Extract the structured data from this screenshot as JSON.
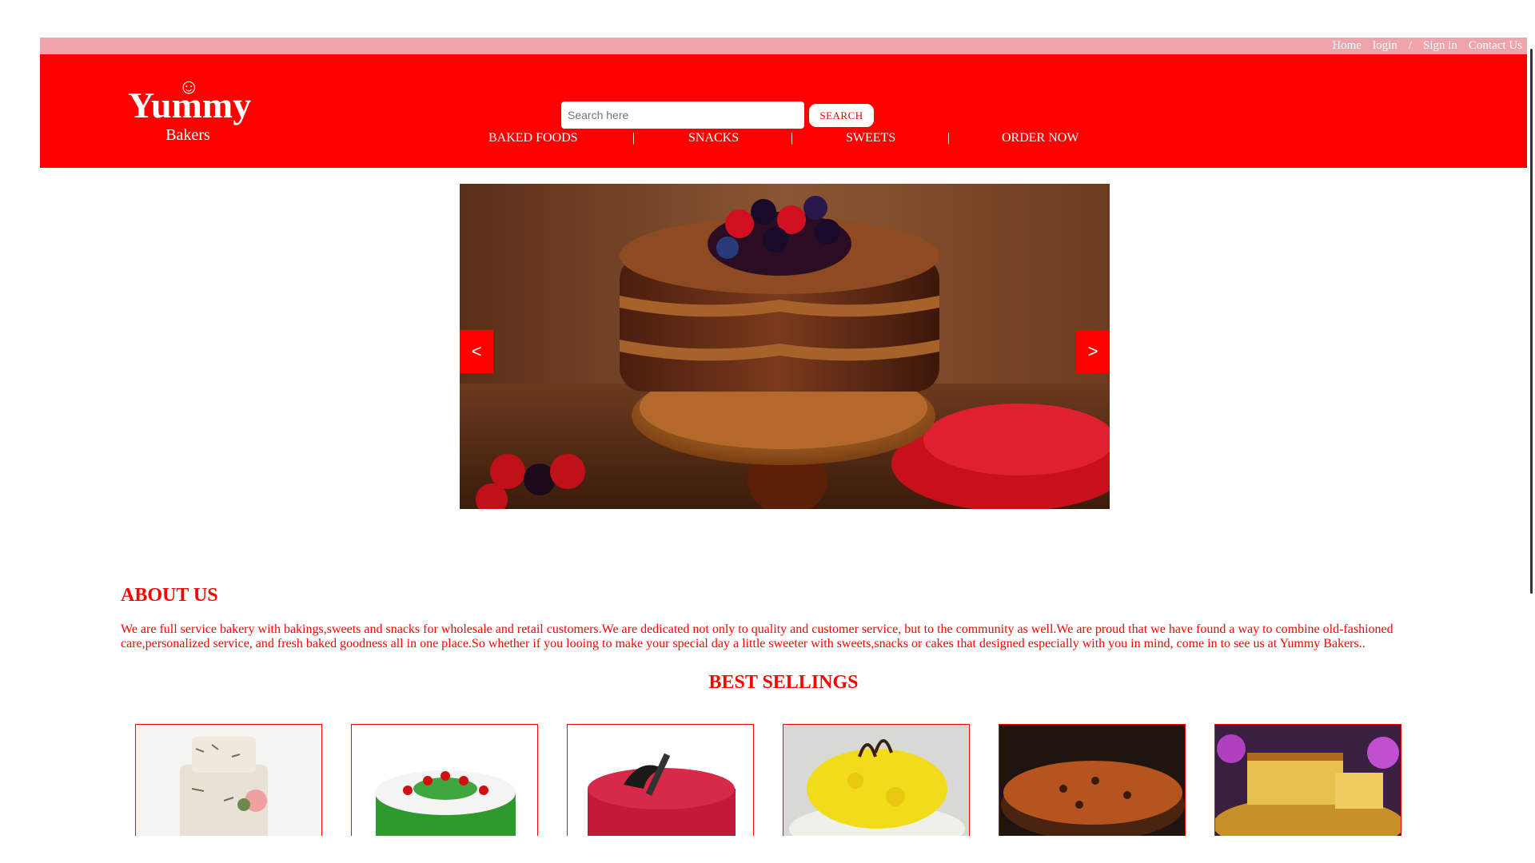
{
  "top_links": [
    "Home",
    "login",
    "/",
    "Sign in",
    "Contact Us"
  ],
  "logo": {
    "icon": "smiley-icon",
    "name": "Yummy",
    "sub": "Bakers"
  },
  "search": {
    "placeholder": "Search here",
    "button": "SEARCH"
  },
  "nav": {
    "items": [
      "BAKED FOODS",
      "SNACKS",
      "SWEETS",
      "ORDER NOW"
    ],
    "separator": "|"
  },
  "slider": {
    "prev": "<",
    "next": ">",
    "image": "chocolate-layer-cake-with-berries"
  },
  "about": {
    "title": "ABOUT US",
    "text": "We are full service bakery with bakings,sweets and snacks for wholesale and retail customers.We are dedicated not only to quality and customer service, but to the community as well.We are proud that we have found a way to combine old-fashioned care,personalized service, and fresh baked goodness all in one place.So whether if you looing to make your special day a little sweeter with sweets,snacks or cakes that designed especially with you in mind, come in to see us at Yummy Bakers.."
  },
  "best": {
    "title": "BEST SELLINGS",
    "products": [
      "birch-wedding-cake",
      "black-forest-cake",
      "red-velvet-cake",
      "pineapple-cake",
      "plum-cake",
      "butter-sponge-cake"
    ]
  },
  "colors": {
    "brand": "#ff0000",
    "topbar": "#efa3ab"
  }
}
